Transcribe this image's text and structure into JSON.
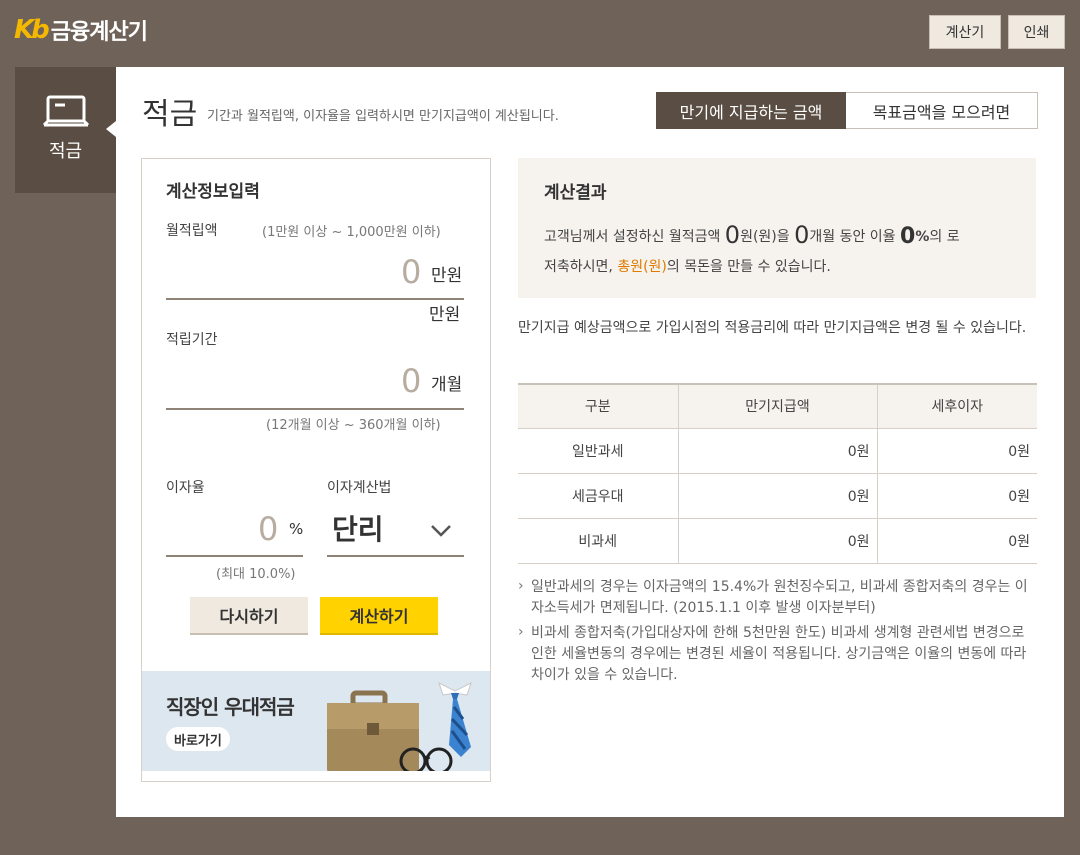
{
  "header": {
    "logo_mark": "Kb",
    "title": "금융계산기",
    "buttons": {
      "calculator": "계산기",
      "print": "인쇄"
    }
  },
  "sidebar": {
    "active_item": "적금"
  },
  "page": {
    "title": "적금",
    "description": "기간과 월적립액, 이자율을 입력하시면 만기지급액이 계산됩니다.",
    "mode_tabs": [
      "만기에 지급하는 금액",
      "목표금액을 모으려면"
    ]
  },
  "input": {
    "title": "계산정보입력",
    "monthly": {
      "label": "월적립액",
      "hint": "(1만원 이상 ~ 1,000만원 이하)",
      "value": "0",
      "unit": "만원",
      "sub_unit": "만원"
    },
    "period": {
      "label": "적립기간",
      "value": "0",
      "unit": "개월",
      "hint": "(12개월 이상 ~ 360개월 이하)"
    },
    "rate": {
      "label": "이자율",
      "value": "0",
      "unit": "%",
      "hint": "(최대 10.0%)"
    },
    "method": {
      "label": "이자계산법",
      "value": "단리"
    },
    "reset_label": "다시하기",
    "submit_label": "계산하기"
  },
  "banner": {
    "title": "직장인 우대적금",
    "link_label": "바로가기"
  },
  "result": {
    "title": "계산결과",
    "line1_pre": "고객님께서 설정하신 월적금액 ",
    "amount": "0",
    "line1_mid1": "원(원)을 ",
    "months": "0",
    "line1_mid2": "개월 동안 이율 ",
    "rate": "0",
    "rate_unit": "%",
    "line1_post": "의 로",
    "line2_pre": "저축하시면, ",
    "total": "총원(원)",
    "line2_post": "의 목돈을 만들 수 있습니다."
  },
  "notice": "만기지급 예상금액으로 가입시점의 적용금리에 따라 만기지급액은 변경 될 수 있습니다.",
  "table": {
    "headers": [
      "구분",
      "만기지급액",
      "세후이자"
    ],
    "rows": [
      [
        "일반과세",
        "0원",
        "0원"
      ],
      [
        "세금우대",
        "0원",
        "0원"
      ],
      [
        "비과세",
        "0원",
        "0원"
      ]
    ]
  },
  "notes": [
    "일반과세의 경우는 이자금액의 15.4%가 원천징수되고, 비과세 종합저축의 경우는 이자소득세가 면제됩니다. (2015.1.1 이후 발생 이자분부터)",
    "비과세 종합저축(가입대상자에 한해 5천만원 한도) 비과세 생계형 관련세법 변경으로 인한 세율변동의 경우에는 변경된 세율이 적용됩니다. 상기금액은 이율의 변동에 따라 차이가 있을 수 있습니다."
  ],
  "colors": {
    "background": "#6f6259",
    "sidebar": "#5a4d43",
    "accent_yellow": "#ffd200",
    "accent_orange": "#e07b00"
  }
}
